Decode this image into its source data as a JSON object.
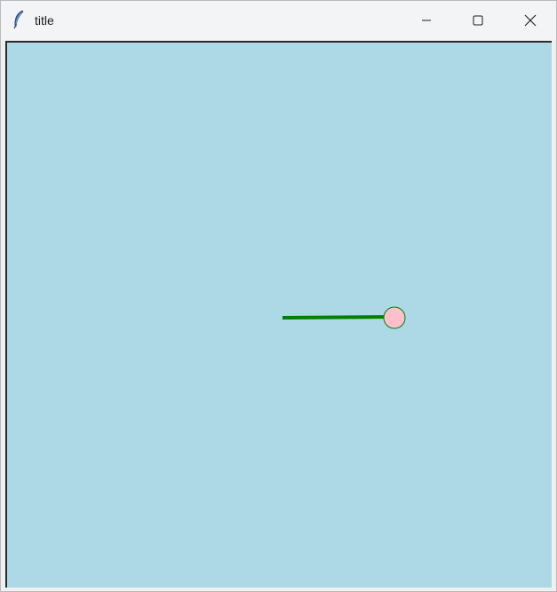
{
  "window": {
    "title": "title",
    "app_icon": "feather-icon",
    "controls": {
      "minimize_icon": "minimize-icon",
      "maximize_icon": "maximize-icon",
      "close_icon": "close-icon"
    }
  },
  "canvas": {
    "background": "#add8e6",
    "pendulum": {
      "rod_color": "#008000",
      "bob_fill": "#ffc0cb",
      "bob_outline": "#008000"
    }
  }
}
